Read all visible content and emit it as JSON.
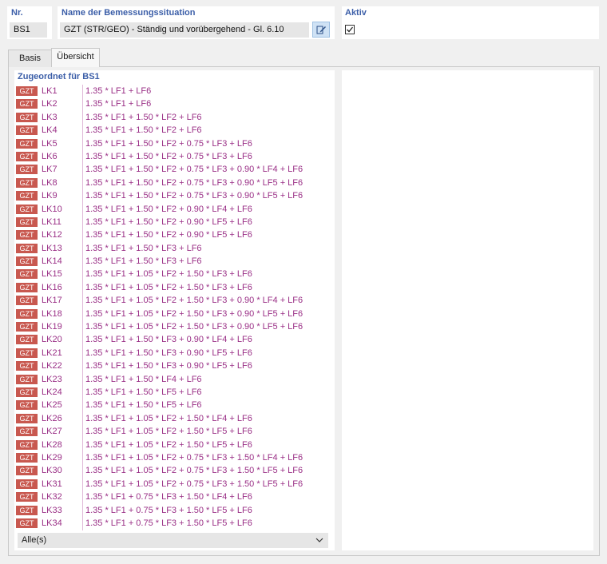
{
  "header": {
    "nr_label": "Nr.",
    "nr_value": "BS1",
    "name_label": "Name der Bemessungssituation",
    "name_value": "GZT (STR/GEO) - Ständig und vorübergehend - Gl. 6.10",
    "aktiv_label": "Aktiv",
    "aktiv_checked": true
  },
  "tabs": [
    {
      "label": "Basis",
      "active": false
    },
    {
      "label": "Übersicht",
      "active": true
    }
  ],
  "list": {
    "title": "Zugeordnet für BS1",
    "badge_color": "#c8584f",
    "text_color": "#9a2f86",
    "rows": [
      {
        "badge": "GZT",
        "lk": "LK1",
        "formula": "1.35 * LF1 + LF6"
      },
      {
        "badge": "GZT",
        "lk": "LK2",
        "formula": "1.35 * LF1 + LF6"
      },
      {
        "badge": "GZT",
        "lk": "LK3",
        "formula": "1.35 * LF1 + 1.50 * LF2 + LF6"
      },
      {
        "badge": "GZT",
        "lk": "LK4",
        "formula": "1.35 * LF1 + 1.50 * LF2 + LF6"
      },
      {
        "badge": "GZT",
        "lk": "LK5",
        "formula": "1.35 * LF1 + 1.50 * LF2 + 0.75 * LF3 + LF6"
      },
      {
        "badge": "GZT",
        "lk": "LK6",
        "formula": "1.35 * LF1 + 1.50 * LF2 + 0.75 * LF3 + LF6"
      },
      {
        "badge": "GZT",
        "lk": "LK7",
        "formula": "1.35 * LF1 + 1.50 * LF2 + 0.75 * LF3 + 0.90 * LF4 + LF6"
      },
      {
        "badge": "GZT",
        "lk": "LK8",
        "formula": "1.35 * LF1 + 1.50 * LF2 + 0.75 * LF3 + 0.90 * LF5 + LF6"
      },
      {
        "badge": "GZT",
        "lk": "LK9",
        "formula": "1.35 * LF1 + 1.50 * LF2 + 0.75 * LF3 + 0.90 * LF5 + LF6"
      },
      {
        "badge": "GZT",
        "lk": "LK10",
        "formula": "1.35 * LF1 + 1.50 * LF2 + 0.90 * LF4 + LF6"
      },
      {
        "badge": "GZT",
        "lk": "LK11",
        "formula": "1.35 * LF1 + 1.50 * LF2 + 0.90 * LF5 + LF6"
      },
      {
        "badge": "GZT",
        "lk": "LK12",
        "formula": "1.35 * LF1 + 1.50 * LF2 + 0.90 * LF5 + LF6"
      },
      {
        "badge": "GZT",
        "lk": "LK13",
        "formula": "1.35 * LF1 + 1.50 * LF3 + LF6"
      },
      {
        "badge": "GZT",
        "lk": "LK14",
        "formula": "1.35 * LF1 + 1.50 * LF3 + LF6"
      },
      {
        "badge": "GZT",
        "lk": "LK15",
        "formula": "1.35 * LF1 + 1.05 * LF2 + 1.50 * LF3 + LF6"
      },
      {
        "badge": "GZT",
        "lk": "LK16",
        "formula": "1.35 * LF1 + 1.05 * LF2 + 1.50 * LF3 + LF6"
      },
      {
        "badge": "GZT",
        "lk": "LK17",
        "formula": "1.35 * LF1 + 1.05 * LF2 + 1.50 * LF3 + 0.90 * LF4 + LF6"
      },
      {
        "badge": "GZT",
        "lk": "LK18",
        "formula": "1.35 * LF1 + 1.05 * LF2 + 1.50 * LF3 + 0.90 * LF5 + LF6"
      },
      {
        "badge": "GZT",
        "lk": "LK19",
        "formula": "1.35 * LF1 + 1.05 * LF2 + 1.50 * LF3 + 0.90 * LF5 + LF6"
      },
      {
        "badge": "GZT",
        "lk": "LK20",
        "formula": "1.35 * LF1 + 1.50 * LF3 + 0.90 * LF4 + LF6"
      },
      {
        "badge": "GZT",
        "lk": "LK21",
        "formula": "1.35 * LF1 + 1.50 * LF3 + 0.90 * LF5 + LF6"
      },
      {
        "badge": "GZT",
        "lk": "LK22",
        "formula": "1.35 * LF1 + 1.50 * LF3 + 0.90 * LF5 + LF6"
      },
      {
        "badge": "GZT",
        "lk": "LK23",
        "formula": "1.35 * LF1 + 1.50 * LF4 + LF6"
      },
      {
        "badge": "GZT",
        "lk": "LK24",
        "formula": "1.35 * LF1 + 1.50 * LF5 + LF6"
      },
      {
        "badge": "GZT",
        "lk": "LK25",
        "formula": "1.35 * LF1 + 1.50 * LF5 + LF6"
      },
      {
        "badge": "GZT",
        "lk": "LK26",
        "formula": "1.35 * LF1 + 1.05 * LF2 + 1.50 * LF4 + LF6"
      },
      {
        "badge": "GZT",
        "lk": "LK27",
        "formula": "1.35 * LF1 + 1.05 * LF2 + 1.50 * LF5 + LF6"
      },
      {
        "badge": "GZT",
        "lk": "LK28",
        "formula": "1.35 * LF1 + 1.05 * LF2 + 1.50 * LF5 + LF6"
      },
      {
        "badge": "GZT",
        "lk": "LK29",
        "formula": "1.35 * LF1 + 1.05 * LF2 + 0.75 * LF3 + 1.50 * LF4 + LF6"
      },
      {
        "badge": "GZT",
        "lk": "LK30",
        "formula": "1.35 * LF1 + 1.05 * LF2 + 0.75 * LF3 + 1.50 * LF5 + LF6"
      },
      {
        "badge": "GZT",
        "lk": "LK31",
        "formula": "1.35 * LF1 + 1.05 * LF2 + 0.75 * LF3 + 1.50 * LF5 + LF6"
      },
      {
        "badge": "GZT",
        "lk": "LK32",
        "formula": "1.35 * LF1 + 0.75 * LF3 + 1.50 * LF4 + LF6"
      },
      {
        "badge": "GZT",
        "lk": "LK33",
        "formula": "1.35 * LF1 + 0.75 * LF3 + 1.50 * LF5 + LF6"
      },
      {
        "badge": "GZT",
        "lk": "LK34",
        "formula": "1.35 * LF1 + 0.75 * LF3 + 1.50 * LF5 + LF6"
      }
    ]
  },
  "filter": {
    "selected": "Alle(s)",
    "icon": "chevron-down-icon"
  }
}
